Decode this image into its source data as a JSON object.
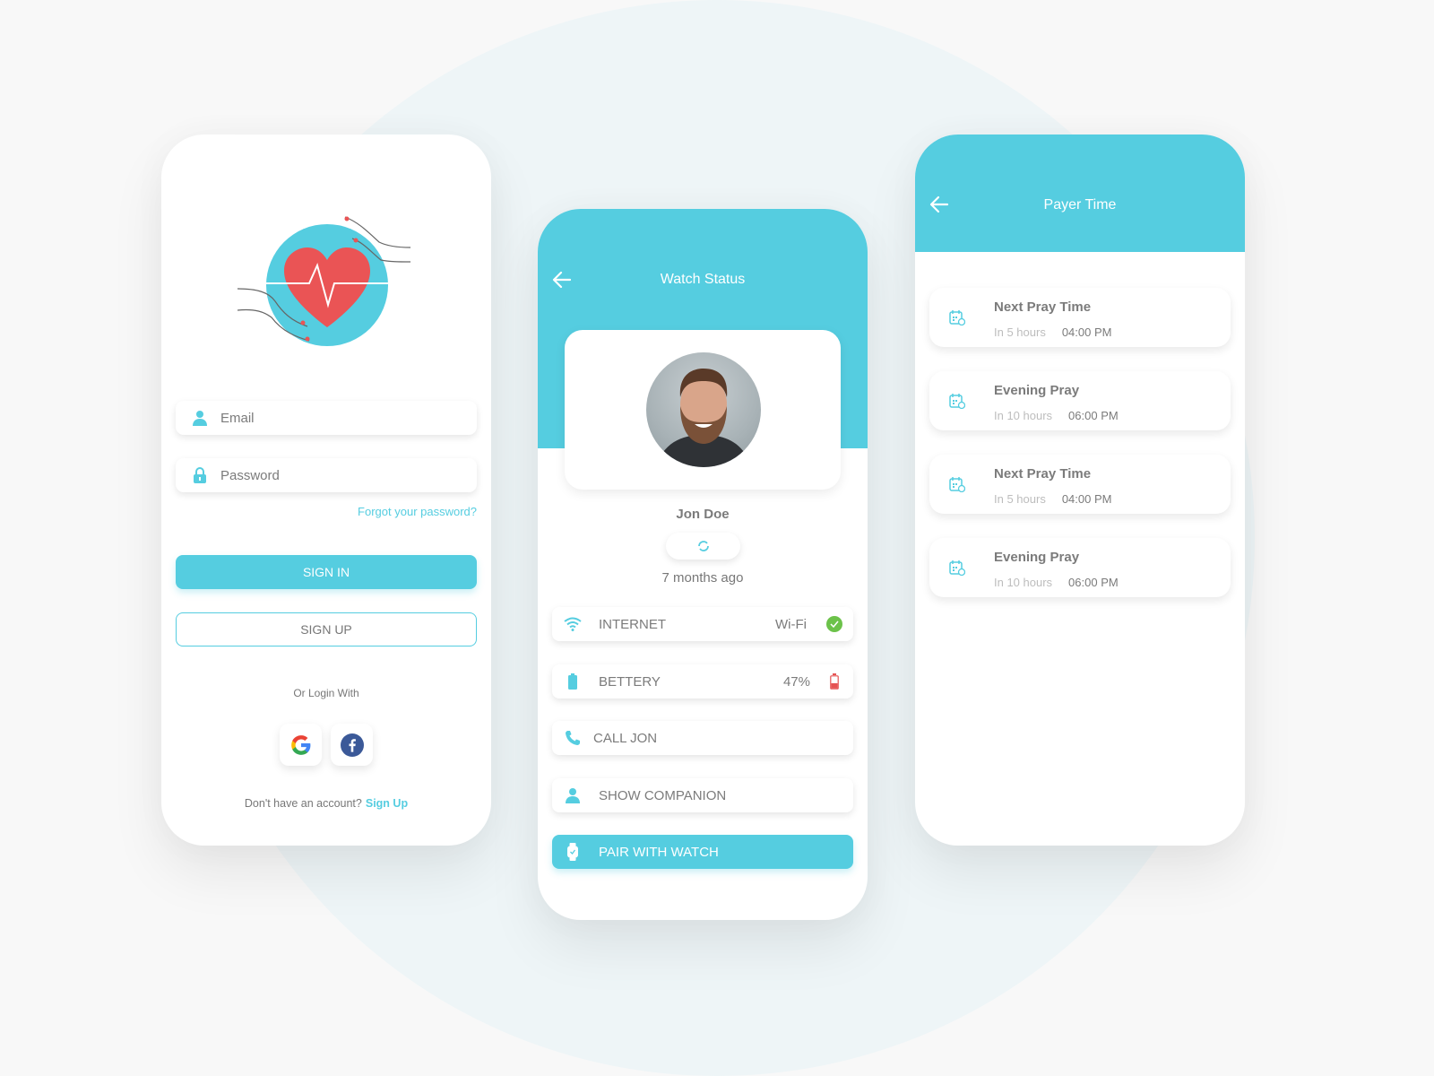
{
  "colors": {
    "accent": "#55cde0",
    "heart": "#ea5455",
    "success": "#6cc24a",
    "battery_low": "#e55353",
    "background": "#f8f8f8",
    "background_circle": "#eef5f7"
  },
  "login": {
    "illustration": "heart-in-hands",
    "email_placeholder": "Email",
    "password_placeholder": "Password",
    "forgot_password": "Forgot your password?",
    "sign_in": "SIGN IN",
    "sign_up": "SIGN UP",
    "or_login_with": "Or Login With",
    "social": [
      {
        "name": "google",
        "icon": "google-icon"
      },
      {
        "name": "facebook",
        "icon": "facebook-icon"
      }
    ],
    "no_account": "Don't have an account?",
    "sign_up_link": "Sign Up"
  },
  "watch_status": {
    "title": "Watch Status",
    "back_icon": "arrow-left-icon",
    "user_name": "Jon Doe",
    "sync_icon": "sync-icon",
    "last_seen": "7 months ago",
    "rows": [
      {
        "icon": "wifi-icon",
        "label": "INTERNET",
        "value": "Wi-Fi",
        "status_icon": "check-circle-icon"
      },
      {
        "icon": "battery-icon",
        "label": "BETTERY",
        "value": "47%",
        "status_icon": "battery-low-icon"
      },
      {
        "icon": "phone-icon",
        "label": "CALL JON"
      },
      {
        "icon": "user-icon",
        "label": "SHOW COMPANION"
      },
      {
        "icon": "watch-icon",
        "label": "PAIR WITH WATCH"
      }
    ]
  },
  "prayer_time": {
    "title": "Payer Time",
    "back_icon": "arrow-left-icon",
    "items": [
      {
        "title": "Next Pray Time",
        "in": "In 5 hours",
        "time": "04:00 PM"
      },
      {
        "title": "Evening Pray",
        "in": "In 10 hours",
        "time": "06:00 PM"
      },
      {
        "title": "Next Pray Time",
        "in": "In 5 hours",
        "time": "04:00 PM"
      },
      {
        "title": "Evening Pray",
        "in": "In 10 hours",
        "time": "06:00 PM"
      }
    ]
  }
}
